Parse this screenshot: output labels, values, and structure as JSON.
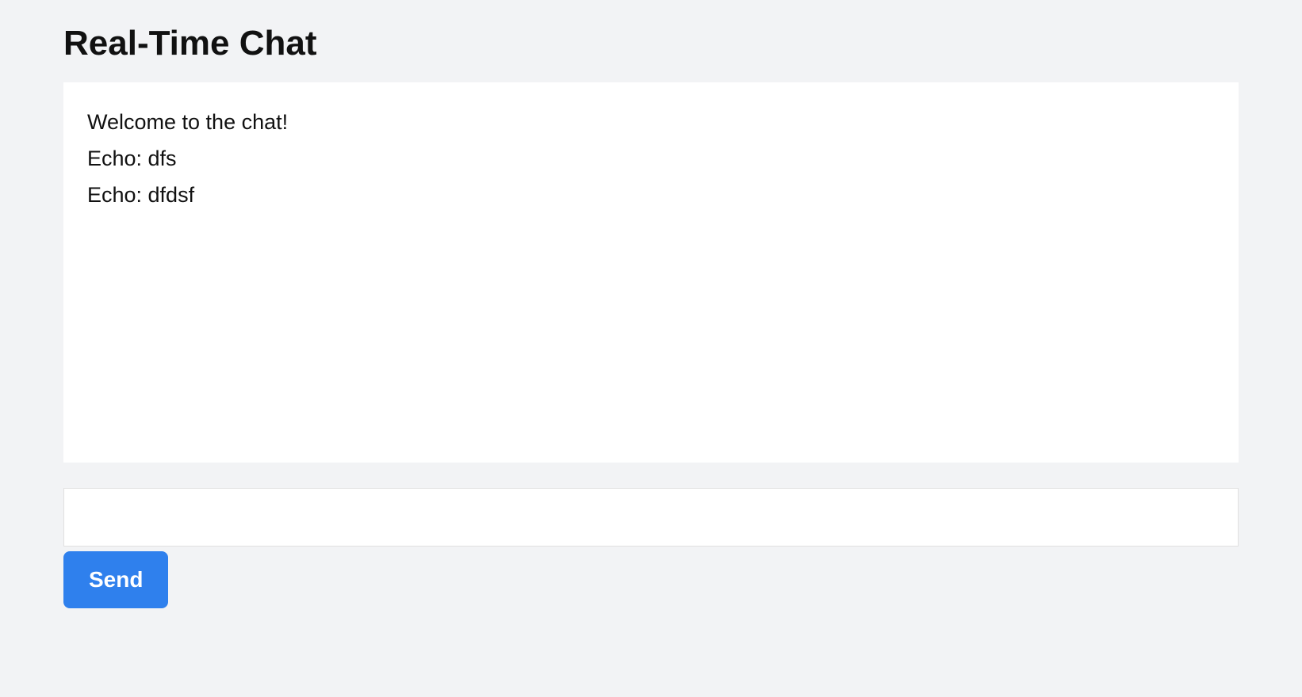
{
  "header": {
    "title": "Real-Time Chat"
  },
  "chat": {
    "messages": [
      "Welcome to the chat!",
      "Echo: dfs",
      "Echo: dfdsf"
    ]
  },
  "composer": {
    "input_value": "",
    "input_placeholder": "",
    "send_label": "Send"
  }
}
